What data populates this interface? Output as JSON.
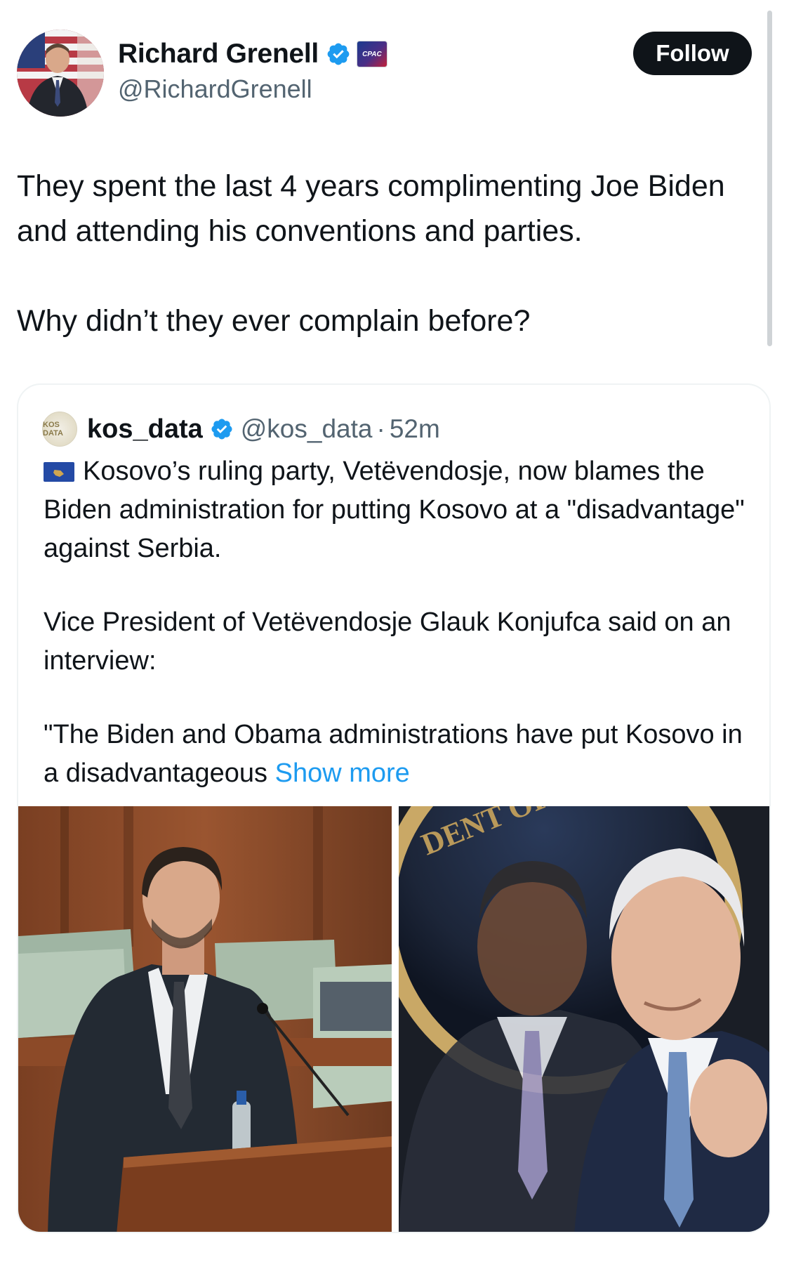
{
  "author": {
    "display_name": "Richard Grenell",
    "handle": "@RichardGrenell",
    "affiliation_badge": "CPAC",
    "follow_label": "Follow"
  },
  "tweet": {
    "paragraphs": [
      "They spent the last 4 years complimenting Joe Biden and attending his conventions and parties.",
      "Why didn’t they ever complain before?"
    ]
  },
  "quoted": {
    "avatar_text": "KOS DATA",
    "name": "kos_data",
    "handle": "@kos_data",
    "separator": "·",
    "time": "52m",
    "paragraphs": [
      "Kosovo’s ruling party, Vetëvendosje, now blames the Biden administration for putting Kosovo at a \"disadvantage\" against Serbia.",
      "Vice President of Vetëvendosje Glauk Konjufca said on an interview:",
      "\"The Biden and Obama administrations have put Kosovo in a disadvantageous"
    ],
    "show_more": "Show more",
    "seal_text": "DENT OF TH"
  },
  "colors": {
    "text_primary": "#0f1419",
    "text_secondary": "#536471",
    "verified_blue": "#1d9bf0",
    "follow_bg": "#0f1419",
    "link": "#1d9bf0"
  },
  "icons": {
    "verified": "verified-badge-icon",
    "affiliation": "cpac-badge-icon",
    "flag": "kosovo-flag-icon"
  }
}
